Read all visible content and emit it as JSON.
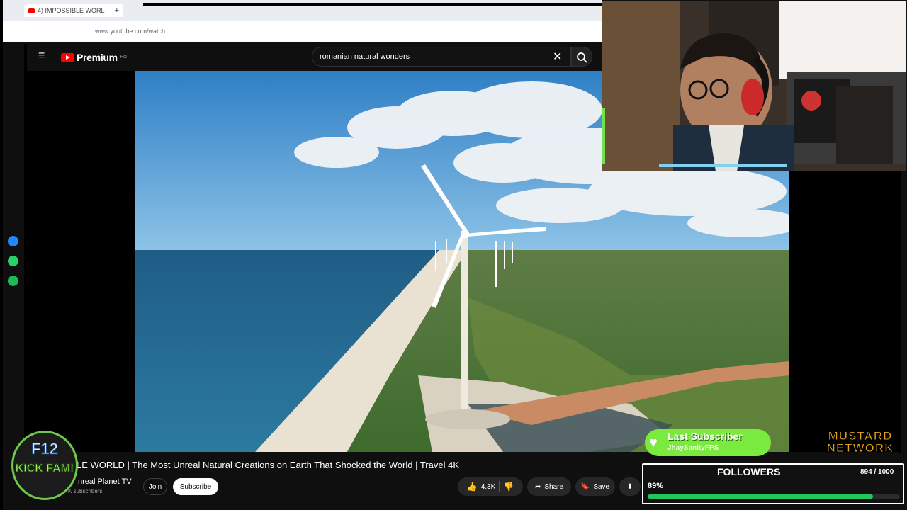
{
  "browser": {
    "tab_title": "4) IMPOSSIBLE WORL",
    "new_tab_icon": "+",
    "url": "www.youtube.com/watch"
  },
  "youtube": {
    "logo_text": "Premium",
    "logo_region": "RO",
    "search_query": "romanian natural wonders",
    "video_title": "LE WORLD | The Most Unreal Natural Creations on Earth That Shocked the World | Travel 4K",
    "channel_name": "nreal Planet TV",
    "subscribers": "K subscribers",
    "join_label": "Join",
    "subscribe_label": "Subscribe",
    "likes": "4.3K",
    "share_label": "Share",
    "save_label": "Save"
  },
  "overlay": {
    "last_subscriber_title": "Last Subscriber",
    "last_subscriber_name": "JhaySanityFPS",
    "followers_label": "FOLLOWERS",
    "followers_count": "894 / 1000",
    "followers_percent": "89%",
    "followers_progress": 0.894,
    "network_logo": "MUSTARD NETWORK",
    "badge_line1": "F12",
    "badge_line2": "KICK FAM!"
  },
  "icons": {
    "menu": "menu-icon",
    "search": "search-icon",
    "clear": "close-icon",
    "like": "thumbs-up-icon",
    "dislike": "thumbs-down-icon",
    "share": "share-icon",
    "save": "save-icon",
    "download": "download-icon"
  },
  "colors": {
    "youtube_red": "#ff0000",
    "progress_green": "#22c55e",
    "last_sub_green": "#7bea3f",
    "mustard": "#e8a61c"
  }
}
